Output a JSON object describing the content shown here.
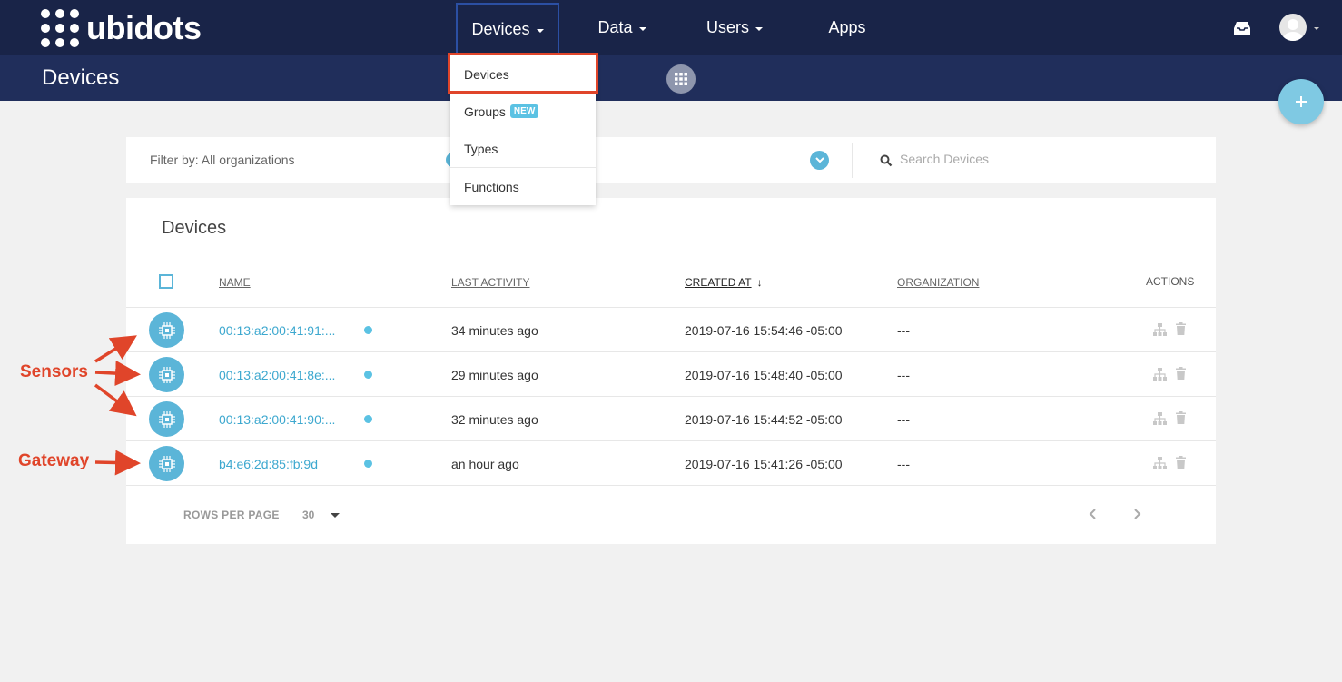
{
  "nav": {
    "brand": "ubidots",
    "items": [
      {
        "label": "Devices",
        "caret": true
      },
      {
        "label": "Data",
        "caret": true
      },
      {
        "label": "Users",
        "caret": true
      },
      {
        "label": "Apps",
        "caret": false
      }
    ]
  },
  "subheader": {
    "title": "Devices"
  },
  "dropdown": {
    "items": [
      {
        "label": "Devices"
      },
      {
        "label": "Groups",
        "badge": "NEW"
      },
      {
        "label": "Types"
      },
      {
        "label": "Functions"
      }
    ]
  },
  "filter": {
    "label": "Filter by: All organizations",
    "search_placeholder": "Search Devices"
  },
  "table": {
    "title": "Devices",
    "columns": {
      "name": "NAME",
      "last_activity": "LAST ACTIVITY",
      "created_at": "CREATED AT",
      "organization": "ORGANIZATION",
      "actions": "ACTIONS"
    },
    "sort_indicator": "↓",
    "rows": [
      {
        "name": "00:13:a2:00:41:91:...",
        "last_activity": "34 minutes ago",
        "created_at": "2019-07-16 15:54:46 -05:00",
        "organization": "---"
      },
      {
        "name": "00:13:a2:00:41:8e:...",
        "last_activity": "29 minutes ago",
        "created_at": "2019-07-16 15:48:40 -05:00",
        "organization": "---"
      },
      {
        "name": "00:13:a2:00:41:90:...",
        "last_activity": "32 minutes ago",
        "created_at": "2019-07-16 15:44:52 -05:00",
        "organization": "---"
      },
      {
        "name": "b4:e6:2d:85:fb:9d",
        "last_activity": "an hour ago",
        "created_at": "2019-07-16 15:41:26 -05:00",
        "organization": "---"
      }
    ],
    "footer": {
      "rows_per_page_label": "ROWS PER PAGE",
      "rows_per_page_value": "30"
    }
  },
  "annotations": {
    "sensors": "Sensors",
    "gateway": "Gateway"
  },
  "colors": {
    "nav_bg": "#192448",
    "subheader_bg": "#202e5b",
    "accent": "#5bb5d8",
    "annotation": "#e0452a"
  }
}
